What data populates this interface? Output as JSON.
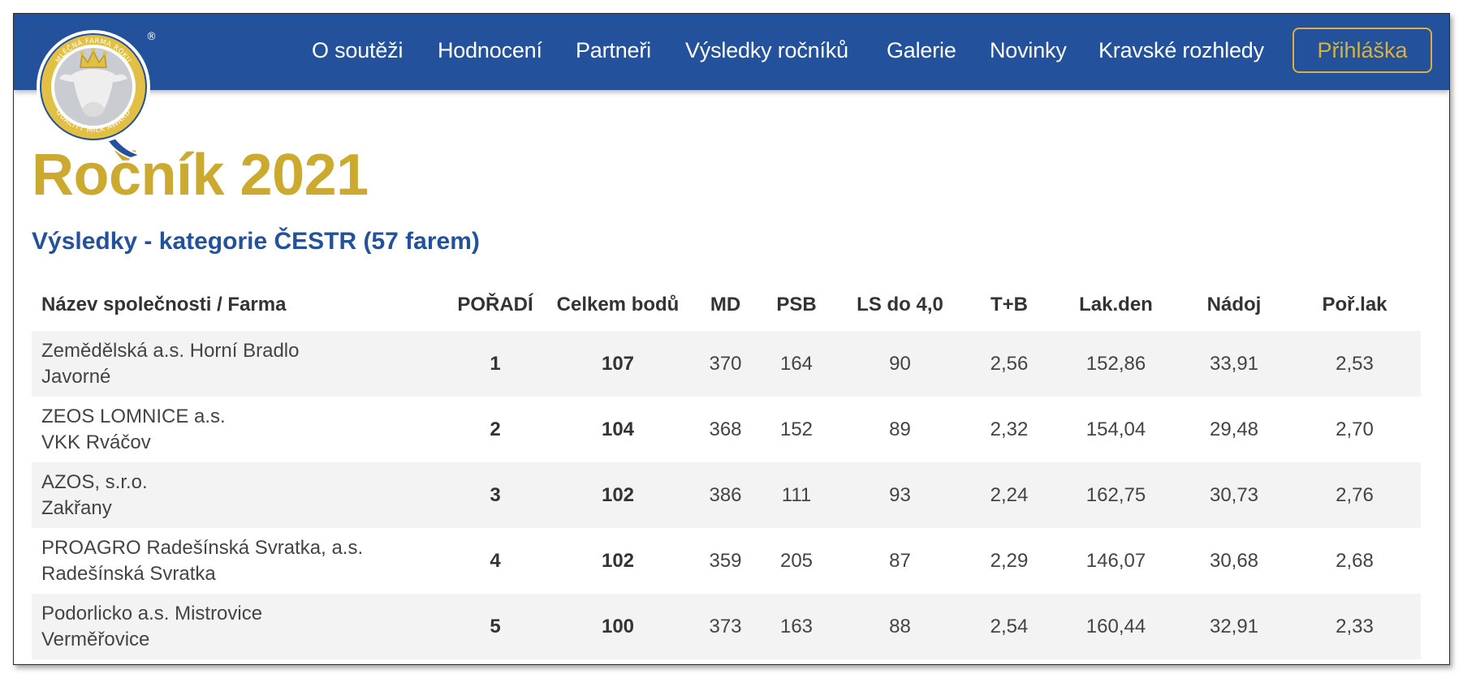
{
  "logo": {
    "top_text": "MLÉČNÁ FARMA ROKU",
    "bottom_text": "QUALITY MILK AWARD",
    "registered": "®"
  },
  "nav": {
    "items": [
      {
        "label": "O soutěži"
      },
      {
        "label": "Hodnocení"
      },
      {
        "label": "Partneři"
      },
      {
        "label": "Výsledky ročníků"
      },
      {
        "label": "Galerie"
      },
      {
        "label": "Novinky"
      },
      {
        "label": "Kravské rozhledy"
      }
    ],
    "cta_label": "Přihláška"
  },
  "colors": {
    "header_bg": "#23519b",
    "accent_gold": "#ccaa30",
    "subtitle_blue": "#23519b"
  },
  "page": {
    "title": "Ročník 2021",
    "subtitle": "Výsledky - kategorie ČESTR (57 farem)"
  },
  "table": {
    "headers": [
      "Název společnosti / Farma",
      "POŘADÍ",
      "Celkem bodů",
      "MD",
      "PSB",
      "LS do 4,0",
      "T+B",
      "Lak.den",
      "Nádoj",
      "Poř.lak"
    ],
    "rows": [
      {
        "company": "Zemědělská a.s. Horní Bradlo",
        "farm": "Javorné",
        "rank": "1",
        "total": "107",
        "md": "370",
        "psb": "164",
        "ls": "90",
        "tb": "2,56",
        "lak_den": "152,86",
        "nadoj": "33,91",
        "por_lak": "2,53"
      },
      {
        "company": "ZEOS LOMNICE a.s.",
        "farm": "VKK Rváčov",
        "rank": "2",
        "total": "104",
        "md": "368",
        "psb": "152",
        "ls": "89",
        "tb": "2,32",
        "lak_den": "154,04",
        "nadoj": "29,48",
        "por_lak": "2,70"
      },
      {
        "company": "AZOS, s.r.o.",
        "farm": "Zakřany",
        "rank": "3",
        "total": "102",
        "md": "386",
        "psb": "111",
        "ls": "93",
        "tb": "2,24",
        "lak_den": "162,75",
        "nadoj": "30,73",
        "por_lak": "2,76"
      },
      {
        "company": "PROAGRO Radešínská Svratka, a.s.",
        "farm": "Radešínská Svratka",
        "rank": "4",
        "total": "102",
        "md": "359",
        "psb": "205",
        "ls": "87",
        "tb": "2,29",
        "lak_den": "146,07",
        "nadoj": "30,68",
        "por_lak": "2,68"
      },
      {
        "company": "Podorlicko a.s. Mistrovice",
        "farm": "Verměřovice",
        "rank": "5",
        "total": "100",
        "md": "373",
        "psb": "163",
        "ls": "88",
        "tb": "2,54",
        "lak_den": "160,44",
        "nadoj": "32,91",
        "por_lak": "2,33"
      }
    ]
  }
}
